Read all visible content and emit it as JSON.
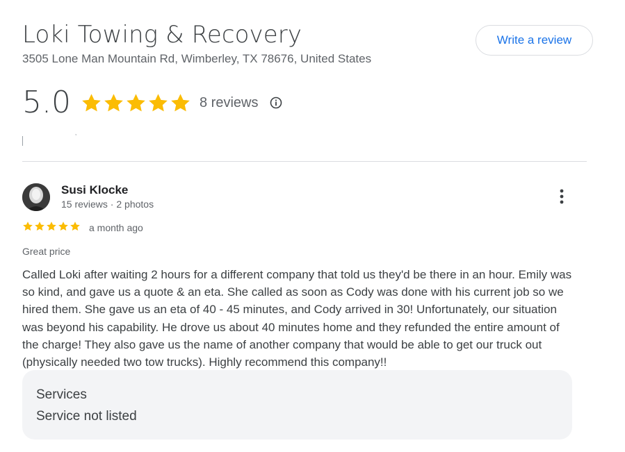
{
  "business": {
    "name": "Loki Towing & Recovery",
    "address": "3505 Lone Man Mountain Rd, Wimberley, TX 78676, United States",
    "write_review_label": "Write a review"
  },
  "rating": {
    "score": "5.0",
    "stars": 5,
    "reviews_count": "8 reviews",
    "info_icon": "info-icon",
    "star_color": "#fbbc04"
  },
  "review": {
    "reviewer_name": "Susi Klocke",
    "reviewer_meta": "15 reviews · 2 photos",
    "stars": 5,
    "time": "a month ago",
    "tag": "Great price",
    "body": "Called Loki after waiting 2 hours for a different company that told us they'd be there in an hour. Emily was so kind, and gave us a quote & an eta. She called as soon as Cody was done with his current job so we hired them. She gave us an eta of 40 - 45 minutes, and Cody arrived in 30! Unfortunately, our situation was beyond his capability. He drove us about 40 minutes home and they refunded the entire amount of the charge! They also gave us the name of another company that would be able to get our truck out (physically needed two tow trucks). Highly recommend this company!!",
    "services_label": "Services",
    "services_value": "Service not listed",
    "more_icon": "more-vert-icon"
  },
  "colors": {
    "accent": "#1a73e8",
    "star": "#fbbc04",
    "divider": "#dadce0",
    "services_bg": "#f3f4f6"
  }
}
